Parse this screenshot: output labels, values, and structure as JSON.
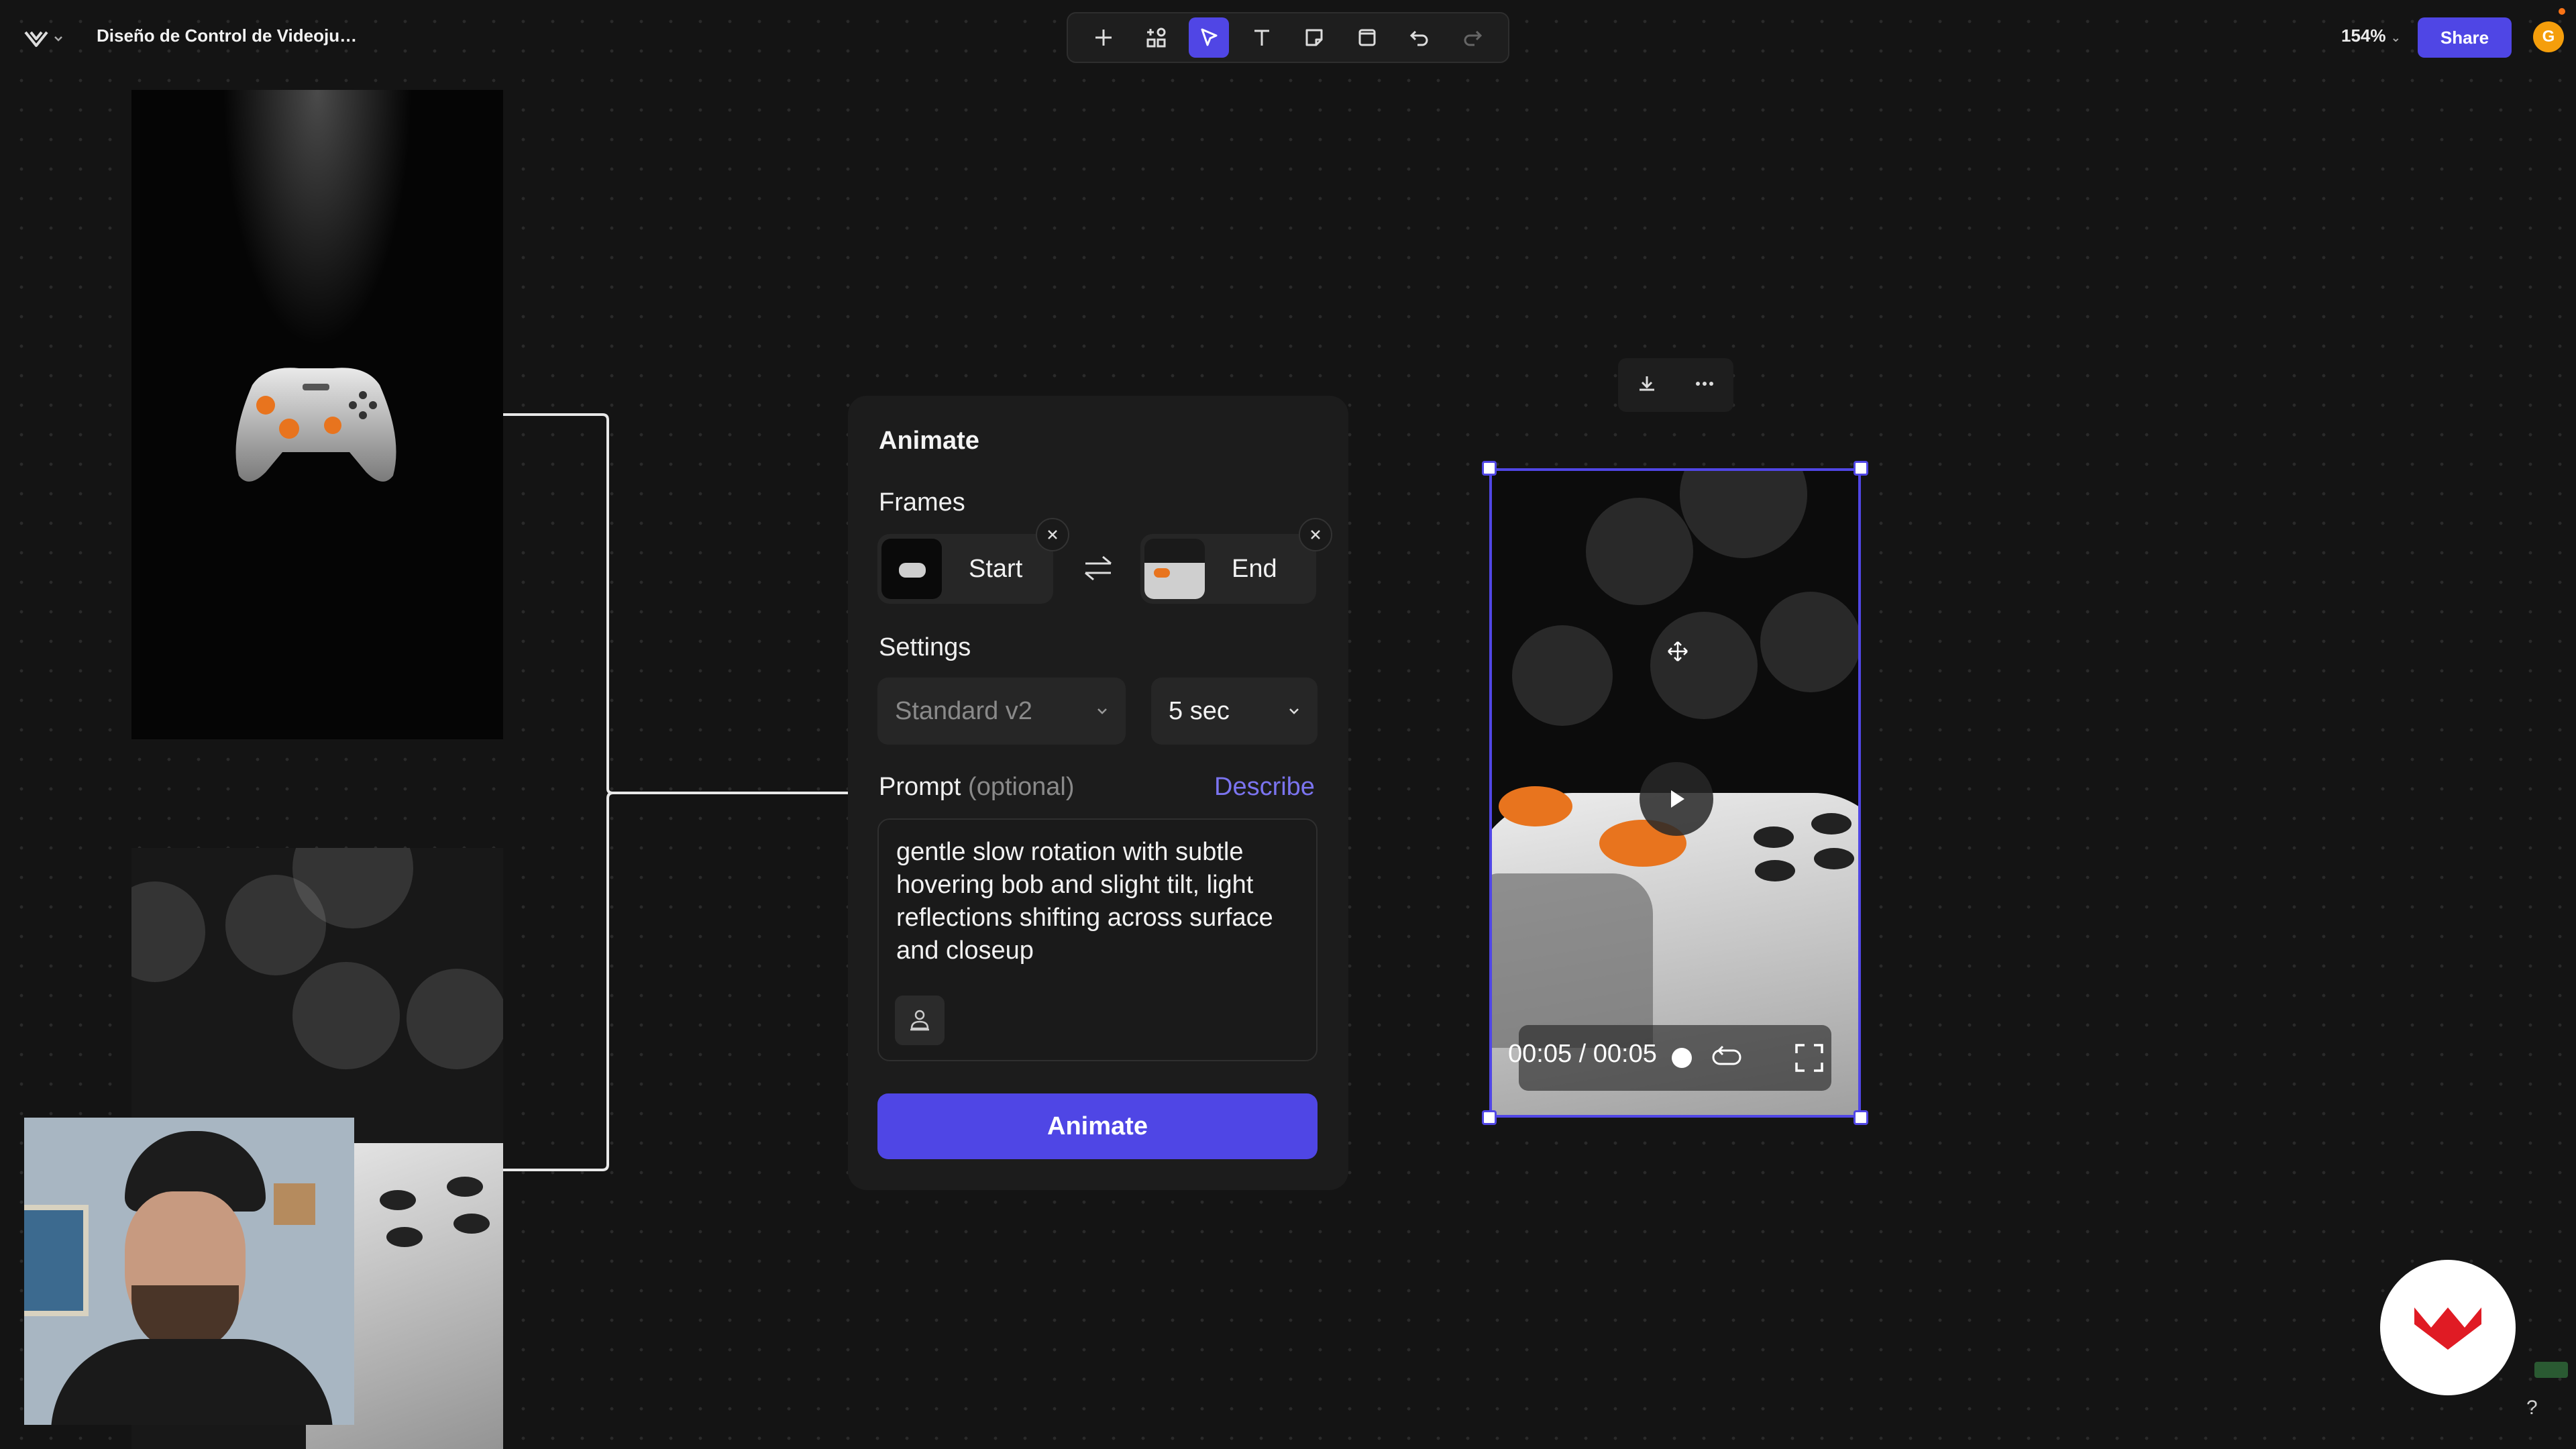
{
  "header": {
    "title": "Diseño de Control de Videoju…",
    "zoom": "154%",
    "share_label": "Share",
    "avatar_initial": "G"
  },
  "toolbar": {
    "tools": [
      "add-icon",
      "component-icon",
      "cursor-icon",
      "text-icon",
      "sticky-note-icon",
      "frame-icon",
      "undo-icon",
      "redo-icon"
    ],
    "active_tool": "cursor-icon"
  },
  "animate_panel": {
    "title": "Animate",
    "frames_label": "Frames",
    "start_label": "Start",
    "end_label": "End",
    "settings_label": "Settings",
    "model_value": "Standard v2",
    "duration_value": "5 sec",
    "prompt_label": "Prompt",
    "prompt_optional": "(optional)",
    "describe_label": "Describe",
    "prompt_text": "gentle slow rotation with subtle hovering bob and slight tilt, light reflections shifting across surface and closeup",
    "button_label": "Animate"
  },
  "video": {
    "time_text": "00:05 / 00:05",
    "progress": 1.0
  },
  "help_label": "?",
  "colors": {
    "accent": "#4f46e5",
    "background": "#141414",
    "panel": "#1c1c1c",
    "brand_red": "#e01b24",
    "orange": "#e8741e"
  }
}
